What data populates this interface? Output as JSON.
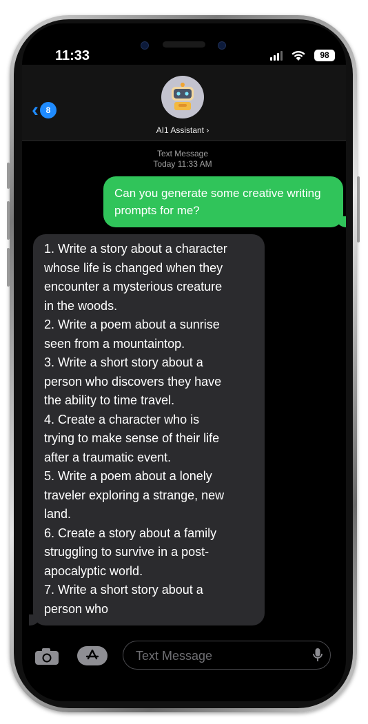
{
  "status_bar": {
    "time": "11:33",
    "battery": "98"
  },
  "header": {
    "back_badge": "8",
    "contact_name": "AI1 Assistant ›"
  },
  "thread_meta": {
    "type": "Text Message",
    "timestamp": "Today 11:33 AM"
  },
  "messages": {
    "outgoing": "Can you generate some creative writing prompts for me?",
    "incoming_lines": [
      "1. Write a story about a character",
      "whose life is changed when they",
      "encounter a mysterious creature",
      "in the woods.",
      "2. Write a poem about a sunrise",
      "seen from a mountaintop.",
      "3. Write a short story about a",
      "person who discovers they have",
      "the ability to time travel.",
      "4. Create a character who is",
      "trying to make sense of their life",
      "after a traumatic event.",
      "5. Write a poem about a lonely",
      "traveler exploring a strange, new",
      "land.",
      "6. Create a story about a family",
      "struggling to survive in a post-",
      "apocalyptic world.",
      "7. Write a short story about a",
      "person who"
    ]
  },
  "input": {
    "placeholder": "Text Message"
  },
  "icons": {
    "back": "chevron-left-icon",
    "avatar": "robot-avatar-icon",
    "camera": "camera-icon",
    "apps": "app-store-icon",
    "mic": "microphone-icon",
    "signal": "signal-icon",
    "wifi": "wifi-icon",
    "battery": "battery-icon"
  },
  "colors": {
    "outgoing_bubble": "#30c45a",
    "incoming_bubble": "#2b2b2e",
    "accent": "#1f8bff",
    "background": "#000000"
  }
}
